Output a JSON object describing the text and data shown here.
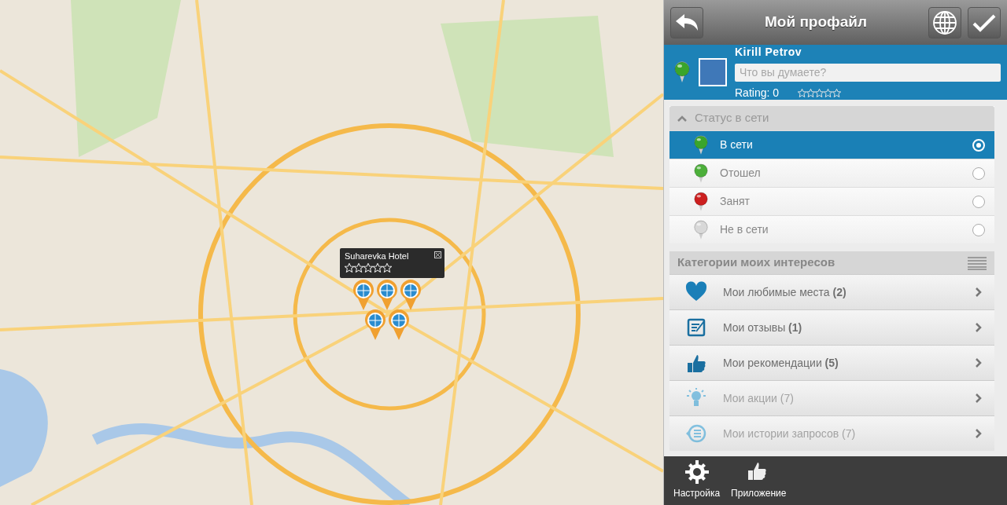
{
  "map": {
    "popup": {
      "title": "Suharevka Hotel",
      "stars": 0
    }
  },
  "header": {
    "title": "Мой профайл"
  },
  "profile": {
    "name": "Kirill Petrov",
    "status_placeholder": "Что вы думаете?",
    "rating": "Rating: 0",
    "stars": 0
  },
  "status_section": {
    "title": "Статус в сети",
    "expanded": true,
    "items": [
      {
        "label": "В сети",
        "color": "#3aa52b",
        "selected": true
      },
      {
        "label": "Отошел",
        "color": "#4caf3a",
        "selected": false
      },
      {
        "label": "Занят",
        "color": "#cc1f1f",
        "selected": false
      },
      {
        "label": "Не в сети",
        "color": "#d8d8d8",
        "selected": false
      }
    ]
  },
  "categories": {
    "title": "Категории моих интересов",
    "items": [
      {
        "kind": "heart",
        "label": "Мои любимые места **(2)**",
        "disabled": false
      },
      {
        "kind": "review",
        "label": "Мои отзывы **(1)**",
        "disabled": false
      },
      {
        "kind": "thumb",
        "label": "Мои рекомендации **(5)**",
        "disabled": false
      },
      {
        "kind": "bulb",
        "label": "Мои акции (7)",
        "disabled": true
      },
      {
        "kind": "history",
        "label": "Мои истории запросов (7)",
        "disabled": true
      }
    ]
  },
  "footer": {
    "items": [
      {
        "kind": "gear",
        "label": "Настройка"
      },
      {
        "kind": "thumb",
        "label": "Приложение"
      }
    ]
  }
}
